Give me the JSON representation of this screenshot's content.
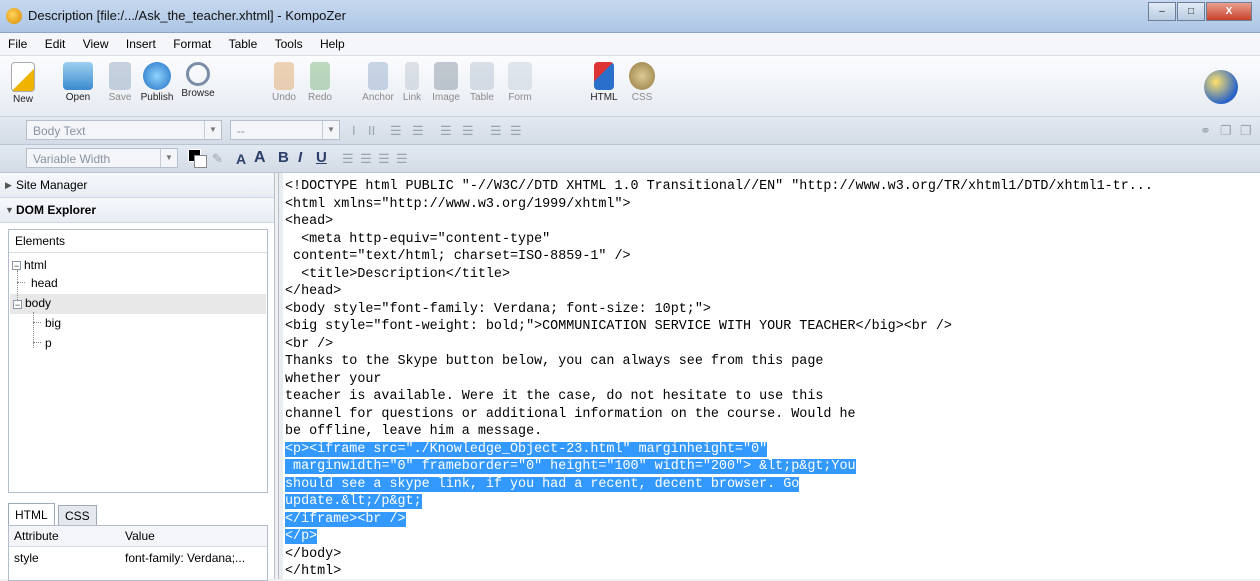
{
  "window": {
    "title": "Description [file:/.../Ask_the_teacher.xhtml] - KompoZer",
    "minimize": "–",
    "maximize": "□",
    "close": "X"
  },
  "menu": [
    "File",
    "Edit",
    "View",
    "Insert",
    "Format",
    "Table",
    "Tools",
    "Help"
  ],
  "toolbar": {
    "new": "New",
    "open": "Open",
    "save": "Save",
    "publish": "Publish",
    "browse": "Browse",
    "undo": "Undo",
    "redo": "Redo",
    "anchor": "Anchor",
    "link": "Link",
    "image": "Image",
    "table": "Table",
    "form": "Form",
    "html": "HTML",
    "css": "CSS"
  },
  "format": {
    "paragraph_style": "Body Text",
    "paragraph_style_extra": "--",
    "font": "Variable Width",
    "bold": "B",
    "italic": "I",
    "underline": "U"
  },
  "sidebar": {
    "site_manager": "Site Manager",
    "dom_explorer": "DOM Explorer",
    "elements_header": "Elements",
    "tree": [
      "html",
      "head",
      "body",
      "big",
      "p"
    ],
    "tabs": {
      "html": "HTML",
      "css": "CSS"
    },
    "attr_headers": {
      "attribute": "Attribute",
      "value": "Value"
    },
    "attr_row": {
      "attribute": "style",
      "value": "font-family: Verdana;..."
    }
  },
  "source_lines": [
    {
      "text": "<!DOCTYPE html PUBLIC \"-//W3C//DTD XHTML 1.0 Transitional//EN\" \"http://www.w3.org/TR/xhtml1/DTD/xhtml1-tr...",
      "selected": false
    },
    {
      "text": "<html xmlns=\"http://www.w3.org/1999/xhtml\">",
      "selected": false
    },
    {
      "text": "<head>",
      "selected": false
    },
    {
      "text": "  <meta http-equiv=\"content-type\"",
      "selected": false
    },
    {
      "text": " content=\"text/html; charset=ISO-8859-1\" />",
      "selected": false
    },
    {
      "text": "  <title>Description</title>",
      "selected": false
    },
    {
      "text": "</head>",
      "selected": false
    },
    {
      "text": "<body style=\"font-family: Verdana; font-size: 10pt;\">",
      "selected": false
    },
    {
      "text": "<big style=\"font-weight: bold;\">COMMUNICATION SERVICE WITH YOUR TEACHER</big><br />",
      "selected": false
    },
    {
      "text": "<br />",
      "selected": false
    },
    {
      "text": "Thanks to the Skype button below, you can always see from this page",
      "selected": false
    },
    {
      "text": "whether your",
      "selected": false
    },
    {
      "text": "teacher is available. Were it the case, do not hesitate to use this",
      "selected": false
    },
    {
      "text": "channel for questions or additional information on the course. Would he",
      "selected": false
    },
    {
      "text": "be offline, leave him a message.",
      "selected": false
    },
    {
      "text": "<p><iframe src=\"./Knowledge_Object-23.html\" marginheight=\"0\"",
      "selected": true
    },
    {
      "text": " marginwidth=\"0\" frameborder=\"0\" height=\"100\" width=\"200\"> &lt;p&gt;You",
      "selected": true
    },
    {
      "text": "should see a skype link, if you had a recent, decent browser. Go",
      "selected": true
    },
    {
      "text": "update.&lt;/p&gt;",
      "selected": true
    },
    {
      "text": "</iframe><br />",
      "selected": true
    },
    {
      "text": "</p>",
      "selected": true
    },
    {
      "text": "</body>",
      "selected": false
    },
    {
      "text": "</html>",
      "selected": false
    }
  ]
}
